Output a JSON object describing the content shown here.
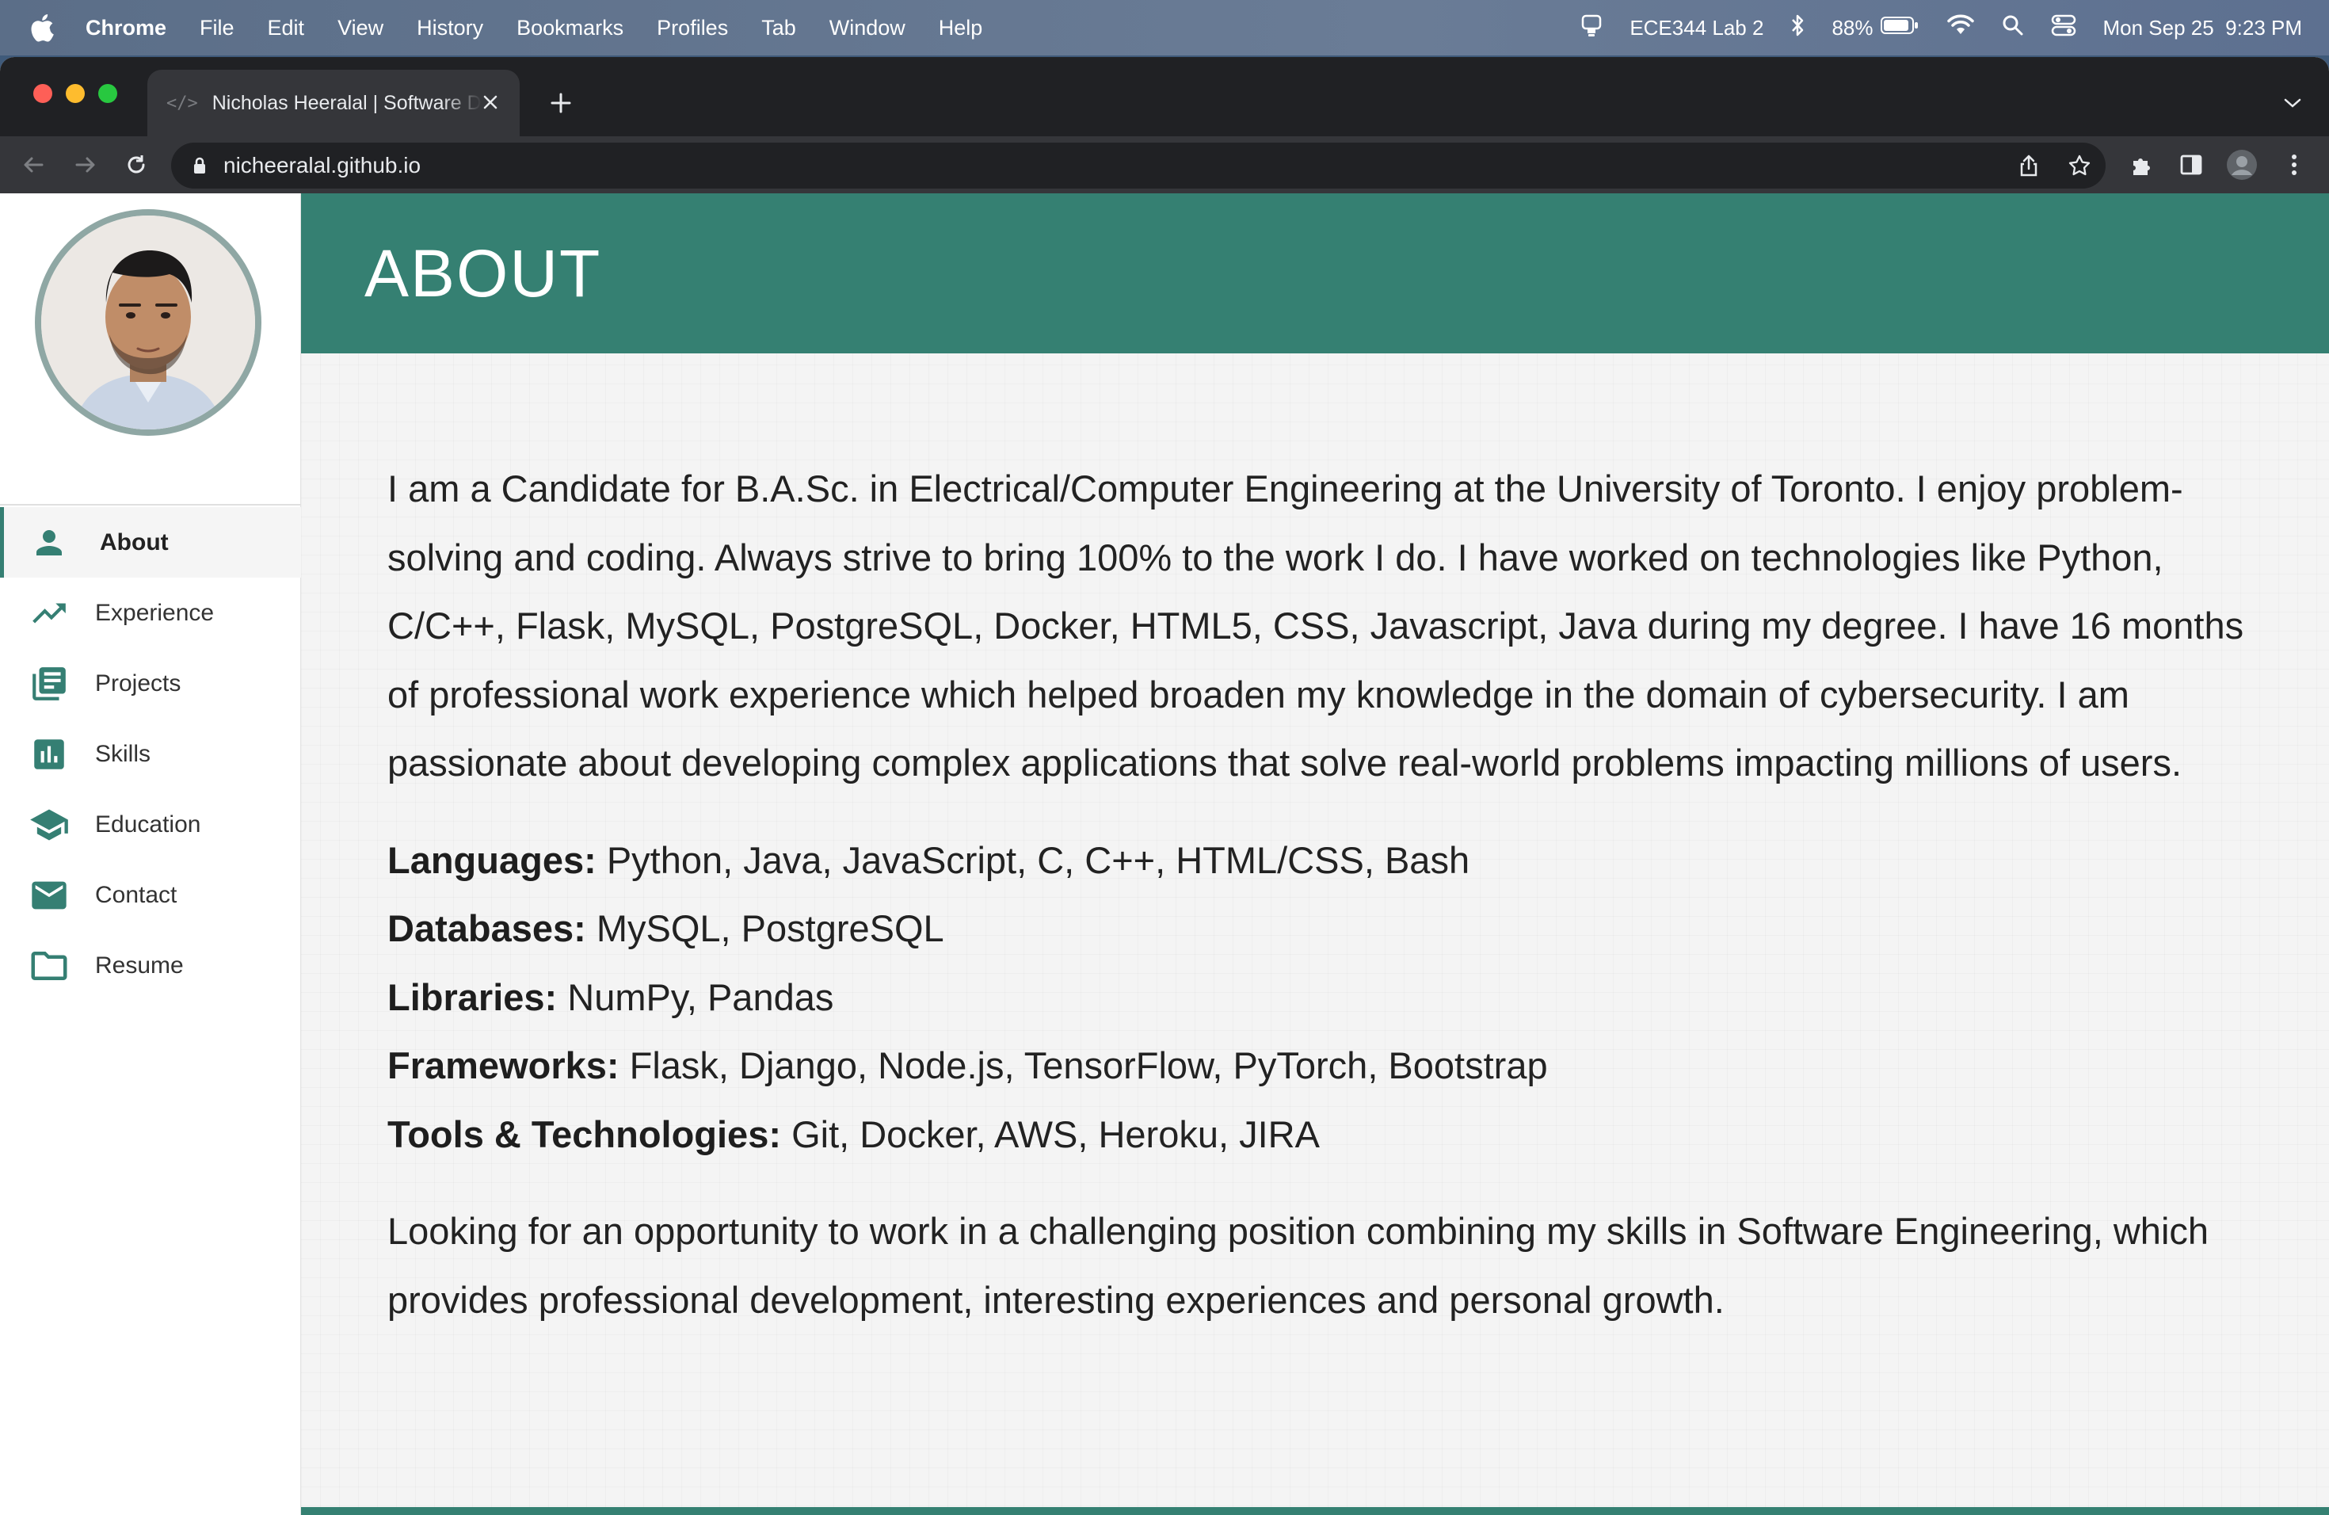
{
  "menubar": {
    "app": "Chrome",
    "items": [
      "File",
      "Edit",
      "View",
      "History",
      "Bookmarks",
      "Profiles",
      "Tab",
      "Window",
      "Help"
    ],
    "status": {
      "focus_label": "ECE344 Lab 2",
      "battery": "88%",
      "date": "Mon Sep 25",
      "time": "9:23 PM"
    }
  },
  "browser": {
    "tab_title": "Nicholas Heeralal | Software D",
    "tab_favicon": "</>",
    "url": "nicheeralal.github.io"
  },
  "sidebar": {
    "items": [
      {
        "label": "About",
        "icon": "person-icon",
        "active": true
      },
      {
        "label": "Experience",
        "icon": "trending-up-icon",
        "active": false
      },
      {
        "label": "Projects",
        "icon": "library-books-icon",
        "active": false
      },
      {
        "label": "Skills",
        "icon": "bar-chart-icon",
        "active": false
      },
      {
        "label": "Education",
        "icon": "school-icon",
        "active": false
      },
      {
        "label": "Contact",
        "icon": "mail-icon",
        "active": false
      },
      {
        "label": "Resume",
        "icon": "folder-icon",
        "active": false
      }
    ]
  },
  "page": {
    "heading": "ABOUT",
    "intro": "I am a Candidate for B.A.Sc. in Electrical/Computer Engineering at the University of Toronto. I enjoy problem-solving and coding. Always strive to bring 100% to the work I do. I have worked on technologies like Python, C/C++, Flask, MySQL, PostgreSQL, Docker, HTML5, CSS, Javascript, Java during my degree. I have 16 months of professional work experience which helped broaden my knowledge in the domain of cybersecurity. I am passionate about developing complex applications that solve real-world problems impacting millions of users.",
    "skills": [
      {
        "label": "Languages:",
        "value": "Python, Java, JavaScript, C, C++, HTML/CSS, Bash"
      },
      {
        "label": "Databases:",
        "value": "MySQL, PostgreSQL"
      },
      {
        "label": "Libraries:",
        "value": "NumPy, Pandas"
      },
      {
        "label": "Frameworks:",
        "value": "Flask, Django, Node.js, TensorFlow, PyTorch, Bootstrap"
      },
      {
        "label": "Tools & Technologies:",
        "value": "Git, Docker, AWS, Heroku, JIRA"
      }
    ],
    "outro": "Looking for an opportunity to work in a challenging position combining my skills in Software Engineering, which provides professional development, interesting experiences and personal growth."
  },
  "colors": {
    "accent": "#358072",
    "sidebar_icon": "#357f73",
    "chrome_dark": "#202124",
    "chrome_toolbar": "#35363a"
  }
}
